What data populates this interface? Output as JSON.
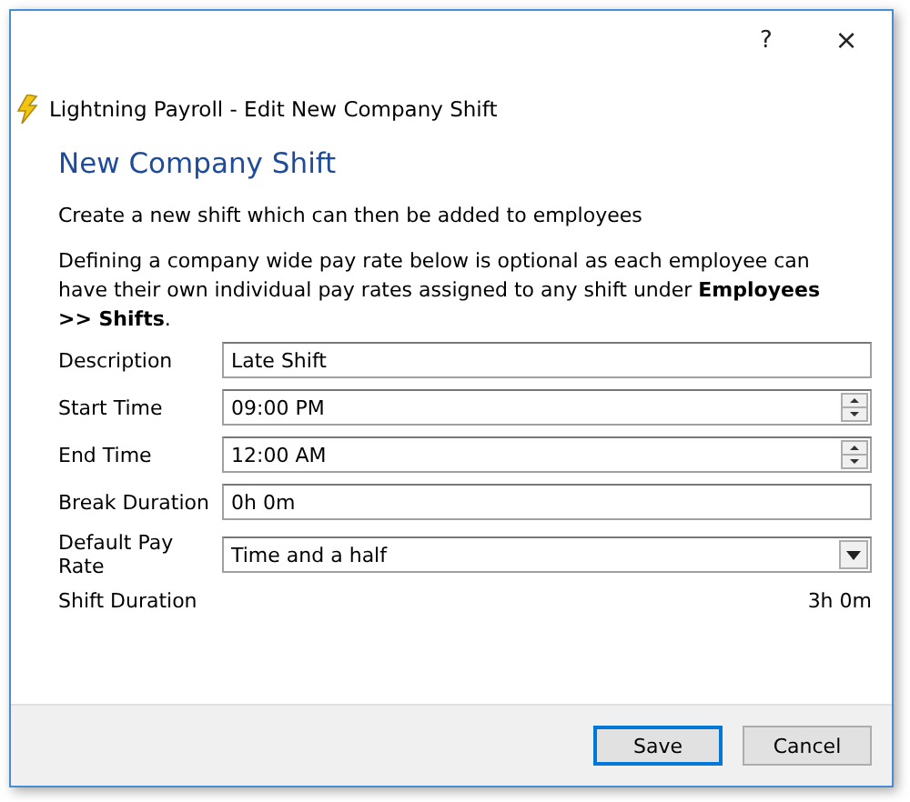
{
  "window": {
    "help_button": "?",
    "close_button": "×",
    "title": "Lightning Payroll - Edit New Company Shift"
  },
  "heading": "New Company Shift",
  "intro": "Create a new shift which can then be added to employees",
  "note": "Defining a company wide pay rate below is optional as each employee can have their own individual pay rates assigned to any shift under **Employees >> Shifts**.",
  "fields": [
    {
      "label": "Description",
      "kind": "text",
      "value": "Late Shift"
    },
    {
      "label": "Start Time",
      "kind": "spinner",
      "value": "09:00 PM"
    },
    {
      "label": "End Time",
      "kind": "spinner",
      "value": "12:00 AM"
    },
    {
      "label": "Break Duration",
      "kind": "text",
      "value": "0h 0m"
    },
    {
      "label": "Default Pay Rate",
      "kind": "dropdown",
      "value": "Time and a half"
    }
  ],
  "shift_duration": {
    "label": "Shift Duration",
    "value": "3h 0m"
  },
  "buttons": [
    {
      "label": "Save",
      "default": true
    },
    {
      "label": "Cancel",
      "default": false
    }
  ]
}
